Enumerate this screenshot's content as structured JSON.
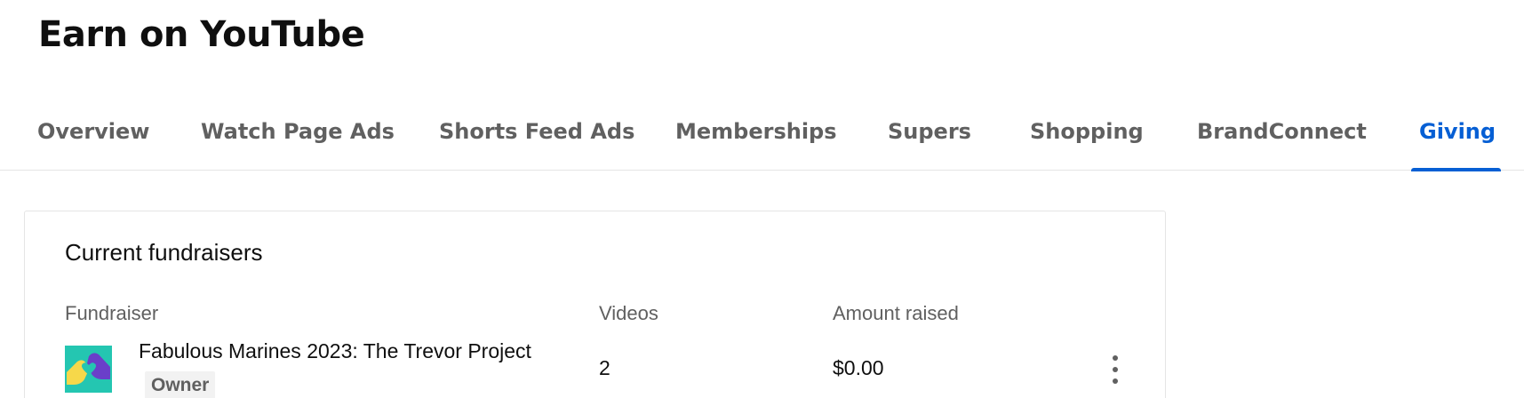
{
  "page": {
    "title": "Earn on YouTube"
  },
  "tabs": [
    {
      "label": "Overview",
      "active": false
    },
    {
      "label": "Watch Page Ads",
      "active": false
    },
    {
      "label": "Shorts Feed Ads",
      "active": false
    },
    {
      "label": "Memberships",
      "active": false
    },
    {
      "label": "Supers",
      "active": false
    },
    {
      "label": "Shopping",
      "active": false
    },
    {
      "label": "BrandConnect",
      "active": false
    },
    {
      "label": "Giving",
      "active": true
    }
  ],
  "fundraisers": {
    "title": "Current fundraisers",
    "columns": {
      "fundraiser": "Fundraiser",
      "videos": "Videos",
      "amount": "Amount raised"
    },
    "rows": [
      {
        "name": "Fabulous Marines 2023: The Trevor Project",
        "badge": "Owner",
        "videos": "2",
        "amount": "$0.00",
        "thumbnail_icon": "heart-hands-icon"
      }
    ]
  },
  "colors": {
    "accent": "#065fd4",
    "muted_text": "#606060",
    "thumb_bg": "#24c6b1"
  }
}
